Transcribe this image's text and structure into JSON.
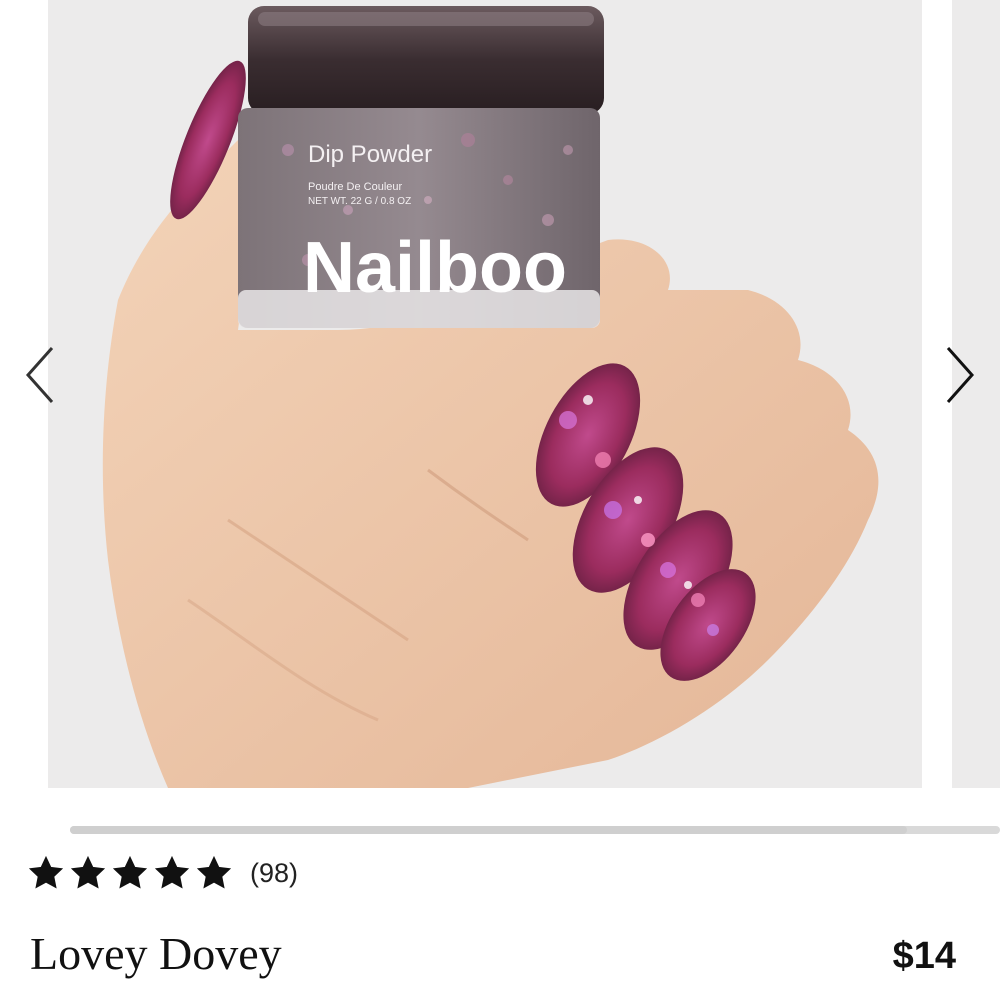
{
  "carousel": {
    "product_image": {
      "jar_label": "Dip Powder",
      "jar_subtitle": "Poudre De Couleur",
      "jar_weight": "NET WT. 22 G / 0.8 OZ",
      "brand_logo": "Nailboo"
    },
    "prev_icon": "chevron-left-icon",
    "next_icon": "chevron-right-icon",
    "scroll_position": 0.0
  },
  "rating": {
    "stars": 5,
    "max_stars": 5,
    "review_count": "(98)",
    "star_color": "#111111"
  },
  "product": {
    "title": "Lovey Dovey",
    "price": "$14"
  }
}
